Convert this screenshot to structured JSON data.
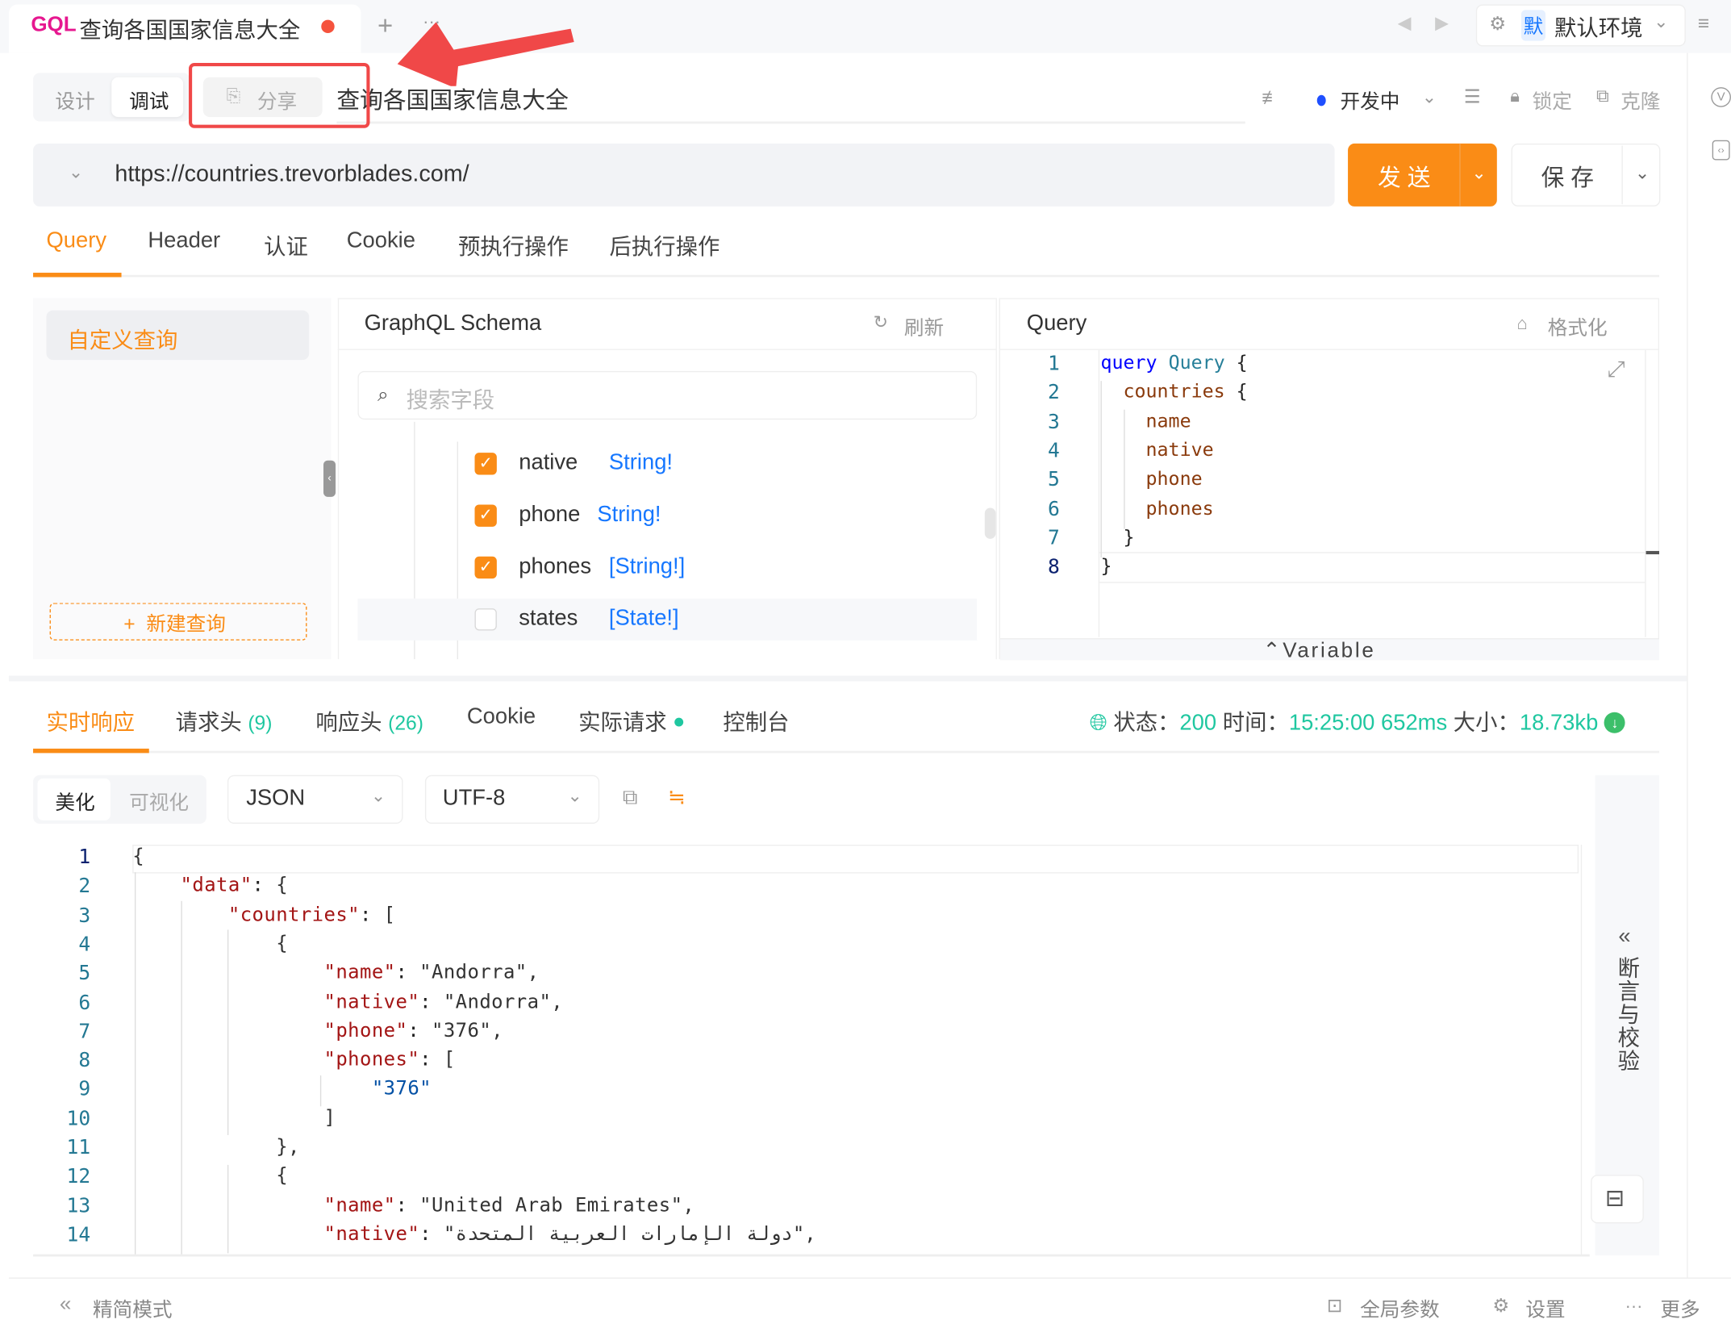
{
  "tabbar": {
    "badge": "GQL",
    "title": "查询各国国家信息大全",
    "add": "+",
    "more": "···",
    "env_badge": "默",
    "env": "默认环境"
  },
  "mode": {
    "design": "设计",
    "debug": "调试",
    "share": "分享",
    "api_title": "查询各国国家信息大全",
    "status": "开发中",
    "lock": "锁定",
    "clone": "克隆"
  },
  "request": {
    "url": "https://countries.trevorblades.com/",
    "send": "发 送",
    "save": "保 存"
  },
  "req_tabs": [
    "Query",
    "Header",
    "认证",
    "Cookie",
    "预执行操作",
    "后执行操作"
  ],
  "left": {
    "custom_query": "自定义查询",
    "new_query": "+  新建查询"
  },
  "schema": {
    "title": "GraphQL Schema",
    "refresh": "刷新",
    "search_placeholder": "搜索字段",
    "fields": [
      {
        "name": "native",
        "type": "String!",
        "checked": true
      },
      {
        "name": "phone",
        "type": "String!",
        "checked": true
      },
      {
        "name": "phones",
        "type": "[String!]",
        "checked": true
      },
      {
        "name": "states",
        "type": "[State!]",
        "checked": false
      }
    ]
  },
  "query": {
    "title": "Query",
    "format": "格式化",
    "variable": "Variable",
    "lines": [
      "query Query {",
      "  countries {",
      "    name",
      "    native",
      "    phone",
      "    phones",
      "  }",
      "}"
    ]
  },
  "resp_tabs": [
    {
      "label": "实时响应"
    },
    {
      "label": "请求头",
      "count": "(9)"
    },
    {
      "label": "响应头",
      "count": "(26)"
    },
    {
      "label": "Cookie"
    },
    {
      "label": "实际请求"
    },
    {
      "label": "控制台"
    }
  ],
  "status": {
    "status_label": "状态：",
    "status": "200",
    "time_label": "时间：",
    "time": "15:25:00",
    "duration": "652ms",
    "size_label": "大小：",
    "size": "18.73kb"
  },
  "resp_toolbar": {
    "pretty": "美化",
    "visual": "可视化",
    "format": "JSON",
    "encoding": "UTF-8"
  },
  "response_lines": [
    "{",
    "    \"data\": {",
    "        \"countries\": [",
    "            {",
    "                \"name\": \"Andorra\",",
    "                \"native\": \"Andorra\",",
    "                \"phone\": \"376\",",
    "                \"phones\": [",
    "                    \"376\"",
    "                ]",
    "            },",
    "            {",
    "                \"name\": \"United Arab Emirates\",",
    "                \"native\": \"دولة الإمارات العربية المتحدة\","
  ],
  "assert_panel": "断言与校验",
  "footer": {
    "simple_mode": "精简模式",
    "global_params": "全局参数",
    "settings": "设置",
    "more": "更多"
  },
  "colors": {
    "accent": "#fa8c16",
    "success": "#1fc7a0",
    "annotation": "#f04848"
  }
}
